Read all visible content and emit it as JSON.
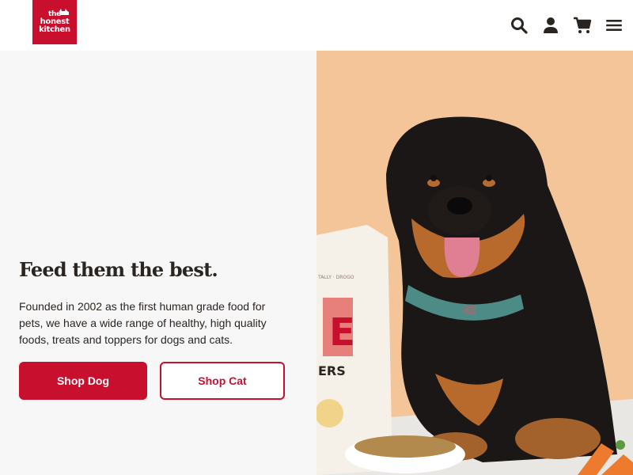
{
  "header": {
    "logo_lines": [
      "the",
      "honest",
      "kitchen"
    ],
    "icons": [
      "search-icon",
      "account-icon",
      "cart-icon",
      "menu-icon"
    ]
  },
  "hero": {
    "title": "Feed them the best.",
    "description": "Founded in 2002 as the first human grade food for pets, we have a wide range of healthy, high quality foods, treats and toppers for dogs and cats.",
    "buttons": {
      "dog": "Shop Dog",
      "cat": "Shop Cat"
    },
    "image_text": {
      "bag_brand": "E",
      "bag_sub": "ERS",
      "bag_top": "TALLY · DROGO"
    }
  },
  "colors": {
    "brand": "#c8102e",
    "text": "#2b2521",
    "hero_bg": "#f5c59a",
    "left_bg": "#f7f7f7"
  }
}
